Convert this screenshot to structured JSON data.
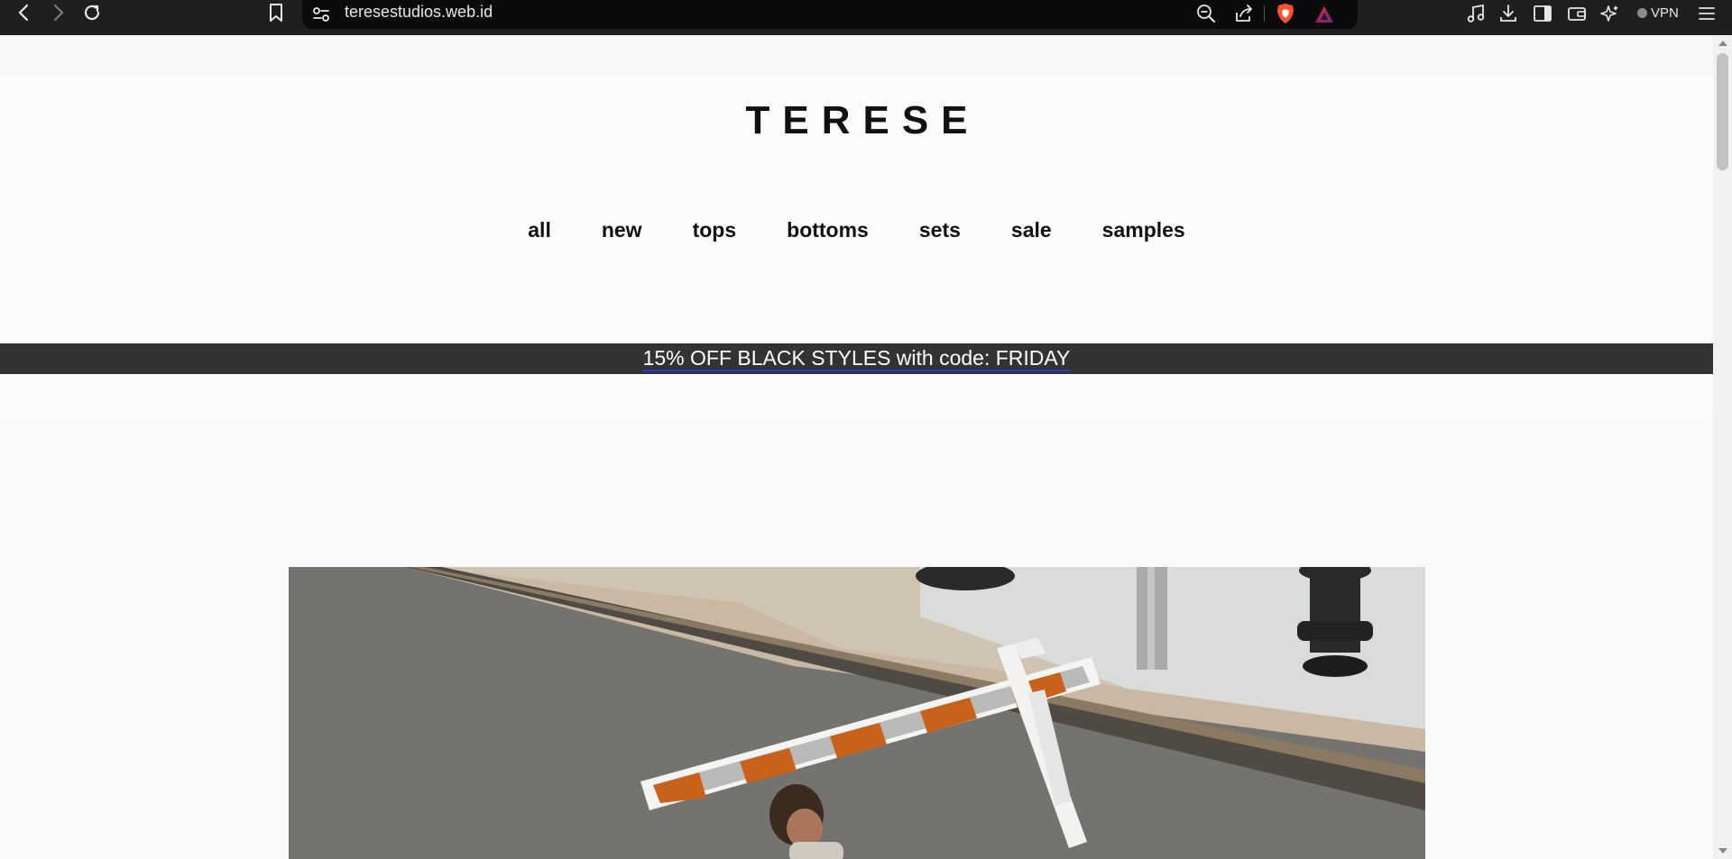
{
  "browser": {
    "url": "teresestudios.web.id",
    "vpn_label": "VPN"
  },
  "site": {
    "logo": "TERESE",
    "menu": [
      "all",
      "new",
      "tops",
      "bottoms",
      "sets",
      "sale",
      "samples"
    ],
    "promo": "15% OFF BLACK STYLES with code: FRIDAY"
  },
  "colors": {
    "chrome_bg": "#1f1f22",
    "promo_bg": "#333333",
    "promo_underline": "#2a3bd1",
    "barricade_orange": "#c8621a"
  },
  "icons": [
    "back-icon",
    "forward-icon",
    "reload-icon",
    "bookmark-icon",
    "site-settings-icon",
    "zoom-out-icon",
    "share-icon",
    "brave-shields-icon",
    "brave-rewards-icon",
    "media-icon",
    "download-icon",
    "sidebar-icon",
    "wallet-icon",
    "leo-ai-icon",
    "menu-icon"
  ]
}
